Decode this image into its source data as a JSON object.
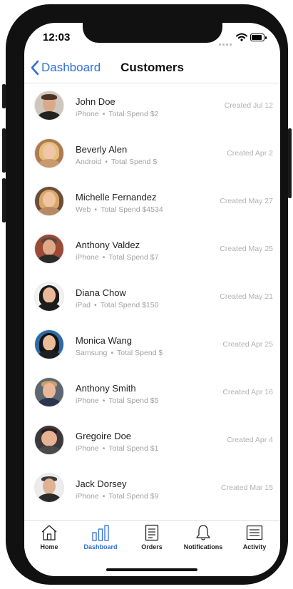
{
  "status_bar": {
    "time": "12:03"
  },
  "nav": {
    "back_label": "Dashboard",
    "title": "Customers"
  },
  "customers": [
    {
      "name": "John Doe",
      "platform": "iPhone",
      "spend": "Total Spend $2",
      "created": "Created Jul 12"
    },
    {
      "name": "Beverly Alen",
      "platform": "Android",
      "spend": "Total Spend $",
      "created": "Created Apr 2"
    },
    {
      "name": "Michelle Fernandez",
      "platform": "Web",
      "spend": "Total Spend $4534",
      "created": "Created May 27"
    },
    {
      "name": "Anthony Valdez",
      "platform": "iPhone",
      "spend": "Total Spend $7",
      "created": "Created May 25"
    },
    {
      "name": "Diana Chow",
      "platform": "iPad",
      "spend": "Total Spend $150",
      "created": "Created May 21"
    },
    {
      "name": "Monica Wang",
      "platform": "Samsung",
      "spend": "Total Spend $",
      "created": "Created Apr 25"
    },
    {
      "name": "Anthony Smith",
      "platform": "iPhone",
      "spend": "Total Spend $5",
      "created": "Created Apr 16"
    },
    {
      "name": "Gregoire Doe",
      "platform": "iPhone",
      "spend": "Total Spend $1",
      "created": "Created Apr 4"
    },
    {
      "name": "Jack Dorsey",
      "platform": "iPhone",
      "spend": "Total Spend $9",
      "created": "Created Mar 15"
    }
  ],
  "separator": "•",
  "tabs": [
    {
      "label": "Home",
      "icon": "home-icon"
    },
    {
      "label": "Dashboard",
      "icon": "bar-chart-icon",
      "active": true
    },
    {
      "label": "Orders",
      "icon": "document-icon"
    },
    {
      "label": "Notifications",
      "icon": "bell-icon"
    },
    {
      "label": "Activity",
      "icon": "list-icon"
    }
  ],
  "colors": {
    "accent": "#2f6fd6",
    "muted_text": "#a2a2a2",
    "frame": "#111111"
  }
}
